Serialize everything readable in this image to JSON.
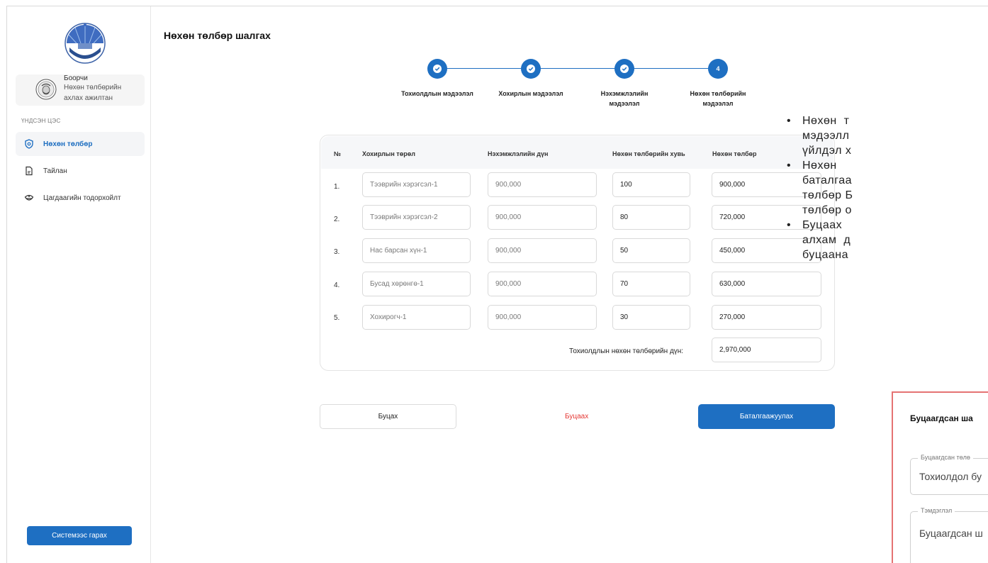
{
  "sidebar": {
    "user": {
      "name": "Боорчи",
      "role": "Нөхөн төлбөрийн ахлах ажилтан"
    },
    "section_label": "ҮНДСЭН ЦЭС",
    "items": [
      {
        "label": "Нөхөн төлбөр",
        "icon": "shield-icon",
        "active": true
      },
      {
        "label": "Тайлан",
        "icon": "document-icon",
        "active": false
      },
      {
        "label": "Цагдаагийн тодорхойлт",
        "icon": "police-cap-icon",
        "active": false
      }
    ],
    "logout_label": "Системээс гарах"
  },
  "page": {
    "title": "Нөхөн төлбөр шалгах"
  },
  "stepper": [
    {
      "label": "Тохиолдлын мэдээлэл",
      "status": "done",
      "number": ""
    },
    {
      "label": "Хохирлын мэдээлэл",
      "status": "done",
      "number": ""
    },
    {
      "label": "Нэхэмжлэлийн мэдээлэл",
      "status": "done",
      "number": ""
    },
    {
      "label": "Нөхөн төлбөрийн мэдээлэл",
      "status": "current",
      "number": "4"
    }
  ],
  "table": {
    "headers": [
      "№",
      "Хохирлын төрөл",
      "Нэхэмжлэлийн дүн",
      "Нөхөн төлбөрийн хувь",
      "Нөхөн төлбөр"
    ],
    "rows": [
      {
        "no": "1.",
        "type": "Тээврийн хэрэгсэл-1",
        "claim": "900,000",
        "percent": "100",
        "payment": "900,000"
      },
      {
        "no": "2.",
        "type": "Тээврийн хэрэгсэл-2",
        "claim": "900,000",
        "percent": "80",
        "payment": "720,000"
      },
      {
        "no": "3.",
        "type": "Нас барсан хүн-1",
        "claim": "900,000",
        "percent": "50",
        "payment": "450,000"
      },
      {
        "no": "4.",
        "type": "Бусад хөрөнгө-1",
        "claim": "900,000",
        "percent": "70",
        "payment": "630,000"
      },
      {
        "no": "5.",
        "type": "Хохирогч-1",
        "claim": "900,000",
        "percent": "30",
        "payment": "270,000"
      }
    ],
    "total_label": "Тохиолдлын нөхөн төлбөрийн дүн:",
    "total_value": "2,970,000"
  },
  "actions": {
    "back": "Буцах",
    "return": "Буцаах",
    "confirm": "Баталгаажуулах"
  },
  "notes": [
    {
      "lines": [
        "Нөхөн  т",
        "мэдээлл",
        "үйлдэл х"
      ]
    },
    {
      "lines": [
        "Нөхөн",
        "баталгаа",
        "төлбөр Б",
        "төлбөр о"
      ]
    },
    {
      "lines": [
        "Буцаах",
        "алхам  д",
        "буцаана"
      ]
    }
  ],
  "modal": {
    "title": "Буцаагдсан ша",
    "field1": {
      "legend": "Буцаагдсан төлө",
      "value": "Тохиолдол бу"
    },
    "field2": {
      "legend": "Тэмдэглэл",
      "value": "Буцаагдсан ш"
    }
  },
  "colors": {
    "primary": "#1e6fc2",
    "danger": "#e53935",
    "modal_border": "#e57373"
  }
}
